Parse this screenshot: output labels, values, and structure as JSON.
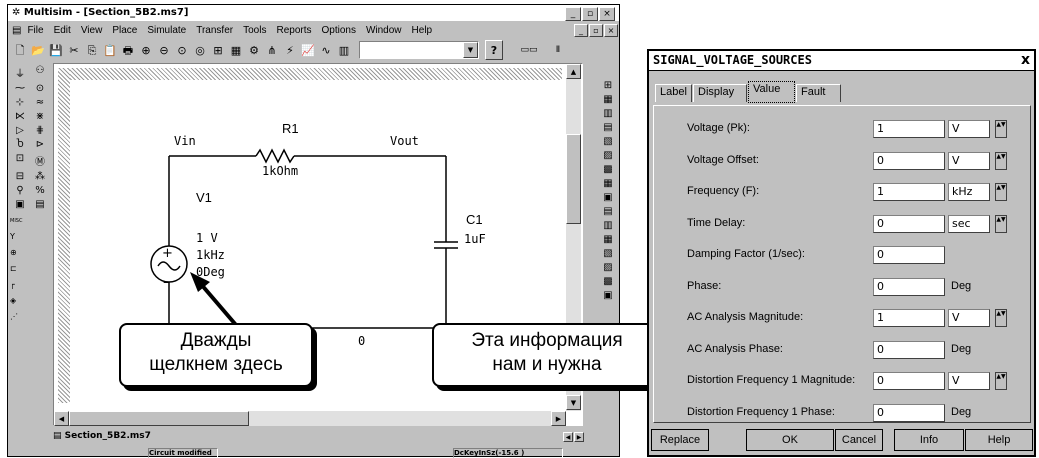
{
  "main_window": {
    "title": "Multisim - [Section_5B2.ms7]",
    "menu": [
      {
        "key": "menu-file",
        "label": "File"
      },
      {
        "key": "menu-edit",
        "label": "Edit"
      },
      {
        "key": "menu-view",
        "label": "View"
      },
      {
        "key": "menu-place",
        "label": "Place"
      },
      {
        "key": "menu-simulate",
        "label": "Simulate"
      },
      {
        "key": "menu-transfer",
        "label": "Transfer"
      },
      {
        "key": "menu-tools",
        "label": "Tools"
      },
      {
        "key": "menu-reports",
        "label": "Reports"
      },
      {
        "key": "menu-options",
        "label": "Options"
      },
      {
        "key": "menu-window",
        "label": "Window"
      },
      {
        "key": "menu-help",
        "label": "Help"
      }
    ],
    "toolbar_help_label": "?",
    "doc_tab": "Section_5B2.ms7",
    "status": {
      "modified": "Circuit modified",
      "right": "DcKeyInSz(-15.6 )"
    }
  },
  "schematic": {
    "vin_label": "Vin",
    "vout_label": "Vout",
    "r1_name": "R1",
    "r1_value": "1kOhm",
    "v1_name": "V1",
    "v1_amp": "1 V",
    "v1_freq": "1kHz",
    "v1_phase": "0Deg",
    "c1_name": "C1",
    "c1_value": "1uF",
    "ground_node": "0"
  },
  "callouts": {
    "left_line1": "Дважды",
    "left_line2": "щелкнем здесь",
    "right_line1": "Эта информация",
    "right_line2": "нам и нужна"
  },
  "dialog": {
    "title": "SIGNAL_VOLTAGE_SOURCES",
    "close": "x",
    "tabs": [
      "Label",
      "Display",
      "Value",
      "Fault"
    ],
    "active_tab": "Value",
    "rows": [
      {
        "label": "Voltage (Pk):",
        "value": "1",
        "unit": "V",
        "unit_field": true
      },
      {
        "label": "Voltage Offset:",
        "value": "0",
        "unit": "V",
        "unit_field": true
      },
      {
        "label": "Frequency (F):",
        "value": "1",
        "unit": "kHz",
        "unit_field": true
      },
      {
        "label": "Time Delay:",
        "value": "0",
        "unit": "sec",
        "unit_field": true
      },
      {
        "label": "Damping Factor (1/sec):",
        "value": "0",
        "unit": "",
        "unit_field": false
      },
      {
        "label": "Phase:",
        "value": "0",
        "unit": "Deg",
        "unit_field": false
      },
      {
        "label": "AC Analysis Magnitude:",
        "value": "1",
        "unit": "V",
        "unit_field": true
      },
      {
        "label": "AC Analysis Phase:",
        "value": "0",
        "unit": "Deg",
        "unit_field": false
      },
      {
        "label": "Distortion Frequency 1 Magnitude:",
        "value": "0",
        "unit": "V",
        "unit_field": true
      },
      {
        "label": "Distortion Frequency 1 Phase:",
        "value": "0",
        "unit": "Deg",
        "unit_field": false
      }
    ],
    "buttons": {
      "replace": "Replace",
      "ok": "OK",
      "cancel": "Cancel",
      "info": "Info",
      "help": "Help"
    }
  }
}
